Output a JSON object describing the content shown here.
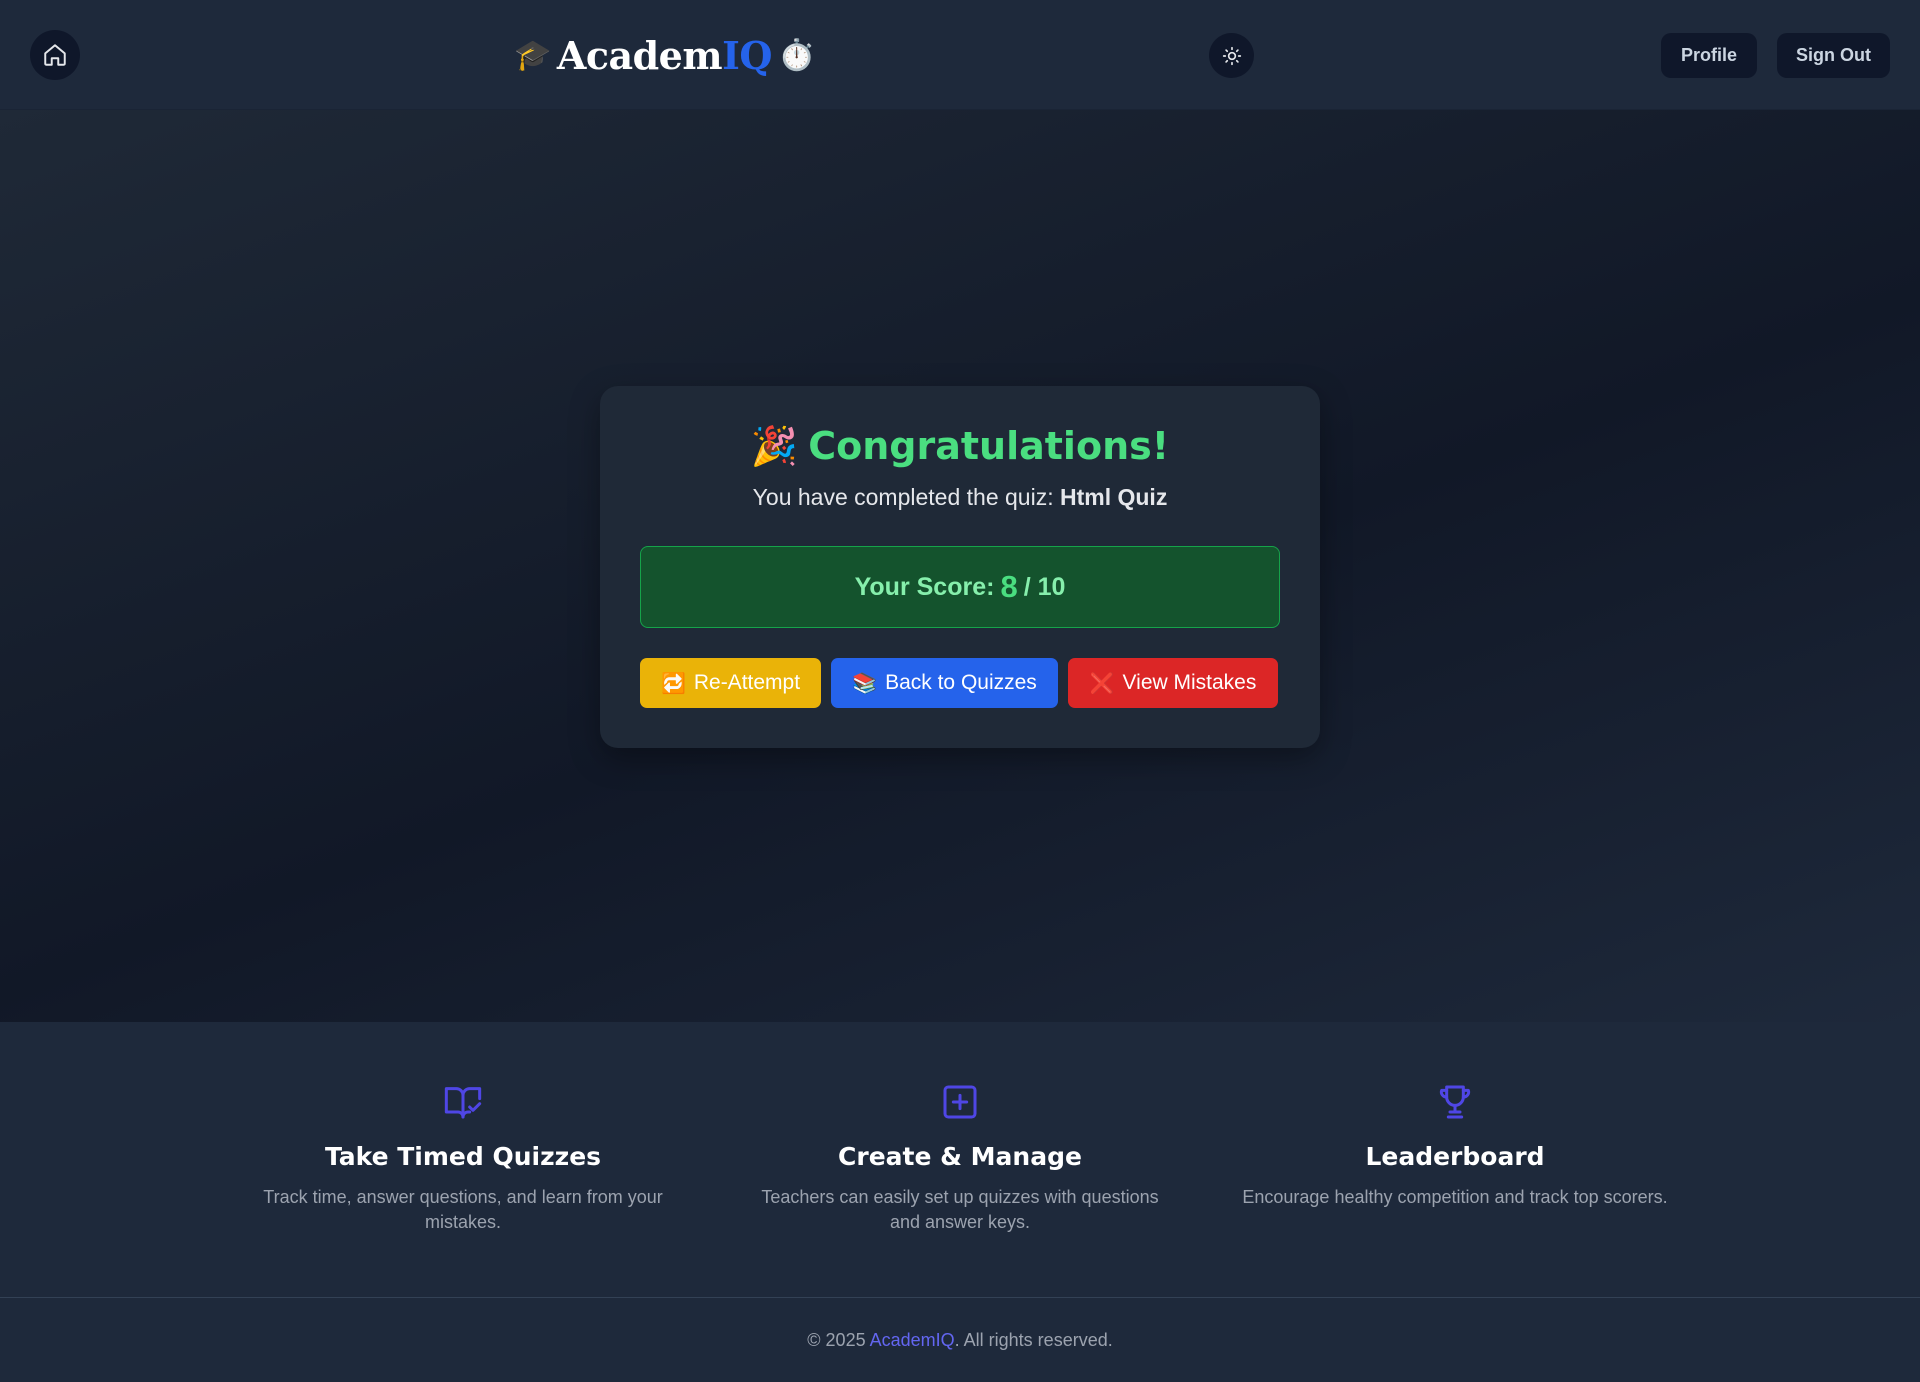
{
  "header": {
    "home_icon": "home-icon",
    "logo": {
      "left_emoji": "🎓",
      "text_main": "Academ",
      "text_accent": "IQ",
      "right_emoji": "⏱️"
    },
    "theme_icon": "sun-icon",
    "nav": {
      "profile_label": "Profile",
      "signout_label": "Sign Out"
    }
  },
  "result": {
    "title_emoji": "🎉",
    "title": "Congratulations!",
    "completed_prefix": "You have completed the quiz: ",
    "quiz_name": "Html Quiz",
    "score_label": "Your Score:",
    "score_value": "8",
    "score_total": "/ 10",
    "score_fraction": 0.8,
    "buttons": {
      "reattempt": {
        "icon": "🔁",
        "label": "Re-Attempt"
      },
      "back": {
        "icon": "📚",
        "label": "Back to Quizzes"
      },
      "mistakes": {
        "icon": "❌",
        "label": "View Mistakes"
      }
    }
  },
  "features": [
    {
      "icon": "book-check-icon",
      "title": "Take Timed Quizzes",
      "description": "Track time, answer questions, and learn from your mistakes."
    },
    {
      "icon": "plus-square-icon",
      "title": "Create & Manage",
      "description": "Teachers can easily set up quizzes with questions and answer keys."
    },
    {
      "icon": "trophy-icon",
      "title": "Leaderboard",
      "description": "Encourage healthy competition and track top scorers."
    }
  ],
  "footer": {
    "prefix": "© 2025 ",
    "brand": "AcademIQ",
    "suffix": ". All rights reserved."
  },
  "colors": {
    "accent_indigo": "#4f46e5",
    "success_green": "#4ade80",
    "warning_yellow": "#eab308",
    "primary_blue": "#2563eb",
    "danger_red": "#dc2626"
  }
}
